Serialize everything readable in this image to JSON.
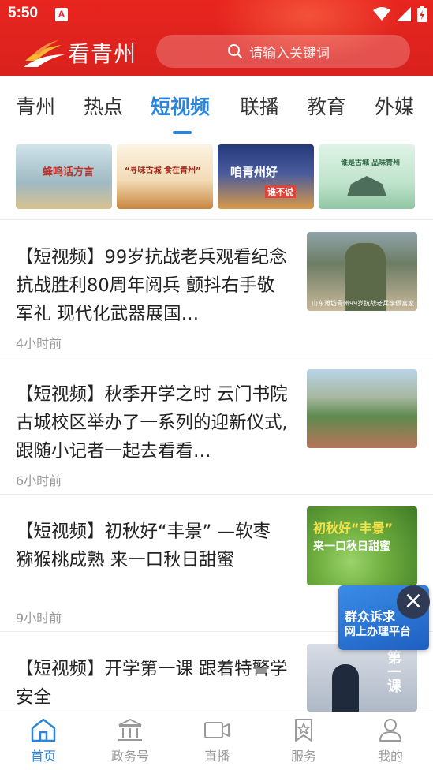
{
  "status_bar": {
    "time": "5:50"
  },
  "header": {
    "app_name": "看青州",
    "search_placeholder": "请输入关键词",
    "brand_color": "#e8251f"
  },
  "tabs": [
    {
      "label": "青州"
    },
    {
      "label": "热点"
    },
    {
      "label": "短视频",
      "active": true
    },
    {
      "label": "联播"
    },
    {
      "label": "教育"
    },
    {
      "label": "外媒"
    }
  ],
  "banners": [
    {
      "caption": "蜂鸣话方言"
    },
    {
      "caption": "“寻味古城 食在青州”"
    },
    {
      "caption": "咱青州好",
      "sub": "谁不说"
    },
    {
      "caption": "谁是古城 品味青州"
    }
  ],
  "news": [
    {
      "title": "【短视频】99岁抗战老兵观看纪念抗战胜利80周年阅兵 颤抖右手敬军礼 现代化武器展国…",
      "time": "4小时前",
      "image_caption": "山东潍坊青州99岁抗战老兵李佩富家"
    },
    {
      "title": "【短视频】秋季开学之时 云门书院古城校区举办了一系列的迎新仪式,跟随小记者一起去看看…",
      "time": "6小时前"
    },
    {
      "title": "【短视频】初秋好“丰景” —软枣猕猴桃成熟 来一口秋日甜蜜",
      "time": "9小时前",
      "image_caption": "初秋好“丰景”",
      "image_sub": "来一口秋日甜蜜"
    },
    {
      "title": "【短视频】开学第一课 跟着特警学安全",
      "time": "",
      "image_caption": "第一课"
    }
  ],
  "float_ad": {
    "line1": "群众诉求",
    "line2": "网上办理平台"
  },
  "bottom_nav": [
    {
      "label": "首页",
      "icon": "home-icon",
      "active": true
    },
    {
      "label": "政务号",
      "icon": "government-icon"
    },
    {
      "label": "直播",
      "icon": "video-camera-icon"
    },
    {
      "label": "服务",
      "icon": "bookmark-star-icon"
    },
    {
      "label": "我的",
      "icon": "user-icon"
    }
  ],
  "accent_color": "#2b86d9"
}
